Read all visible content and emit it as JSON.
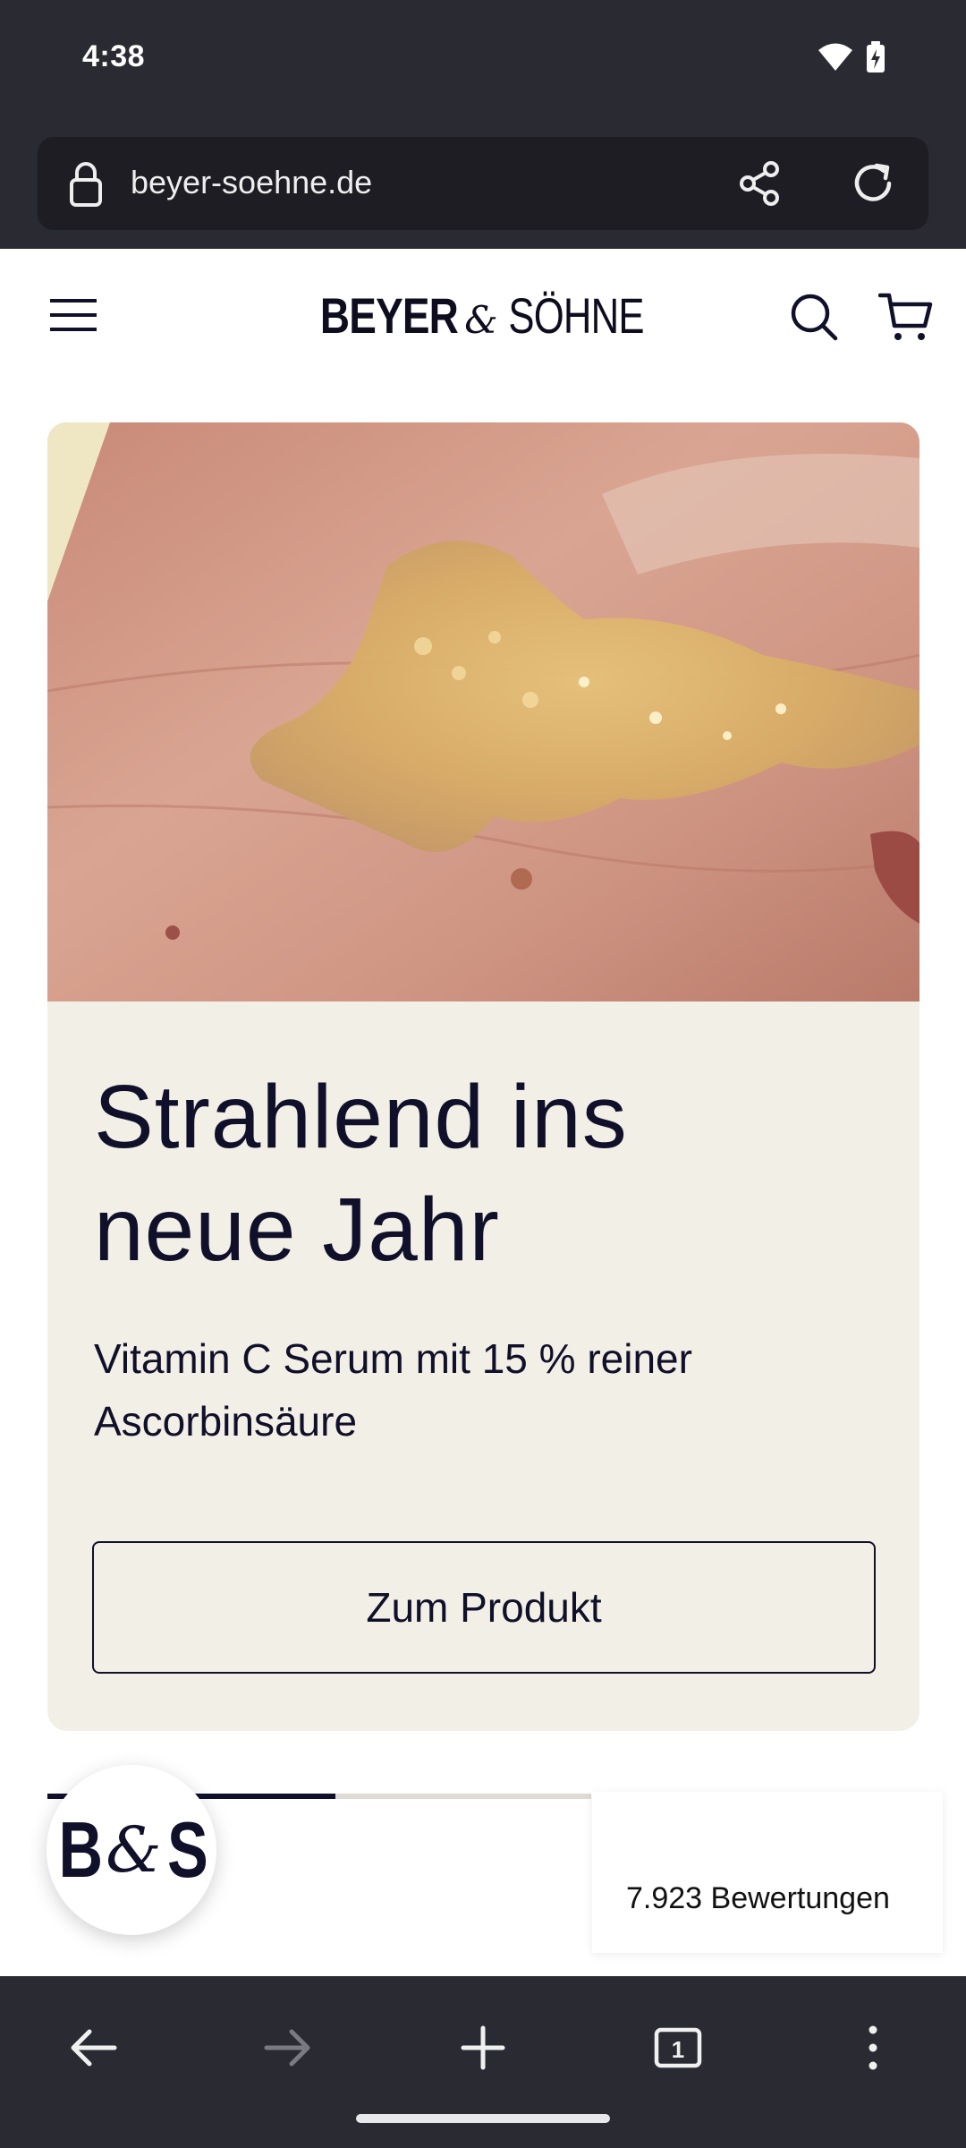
{
  "status_bar": {
    "time": "4:38"
  },
  "browser": {
    "url": "beyer-soehne.de",
    "tab_count": "1",
    "icons": {
      "lock": "lock-icon",
      "share": "share-icon",
      "reload": "reload-icon",
      "back": "back-arrow-icon",
      "forward": "forward-arrow-icon",
      "new_tab": "plus-icon",
      "tabs": "tab-switcher-icon",
      "menu": "more-vert-icon"
    }
  },
  "site": {
    "brand_left": "BEYER",
    "brand_amp": "&",
    "brand_right": "SÖHNE",
    "badge_b": "B",
    "badge_amp": "&",
    "badge_s": "S"
  },
  "hero": {
    "title_line1": "Strahlend ins",
    "title_line2": "neue Jahr",
    "subtitle_line1": "Vitamin C Serum mit 15 % reiner",
    "subtitle_line2": "Ascorbinsäure",
    "cta_label": "Zum Produkt"
  },
  "carousel": {
    "active_index": 1,
    "visible_segments": 2
  },
  "reviews": {
    "label": "7.923 Bewertungen"
  },
  "colors": {
    "ink": "#10102a",
    "card_bg": "#f2efe6",
    "browser_chrome": "#2a2a33",
    "url_bar": "#1d1d23"
  }
}
